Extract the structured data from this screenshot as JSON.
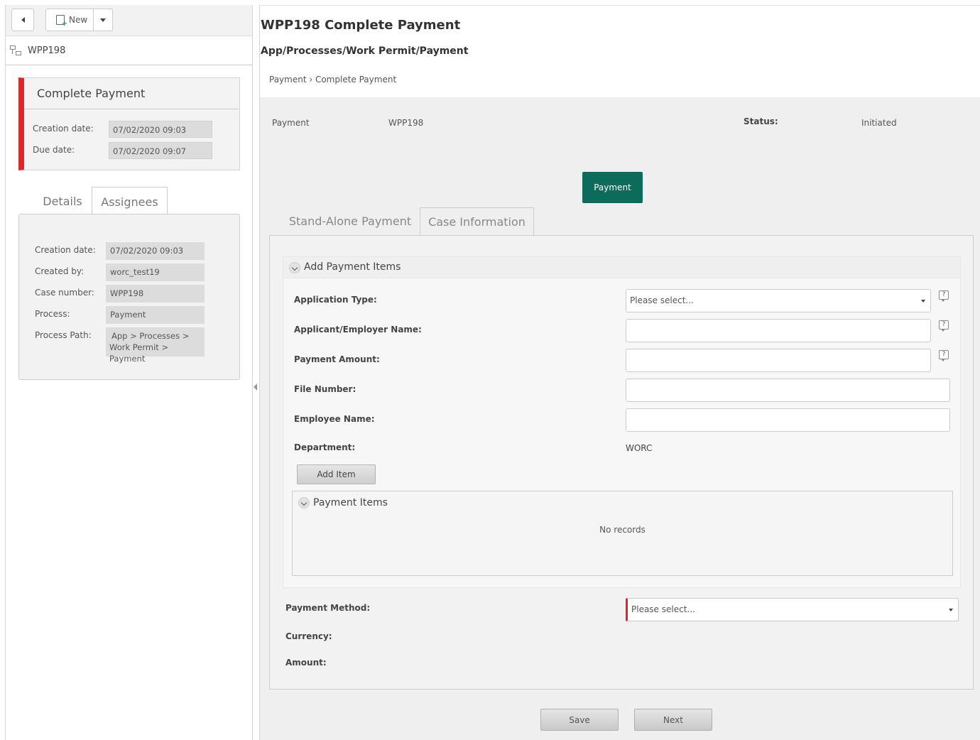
{
  "left": {
    "toolbar": {
      "new_label": "New"
    },
    "case_name": "WPP198",
    "task": {
      "title": "Complete Payment",
      "creation_label": "Creation date:",
      "creation_value": "07/02/2020 09:03",
      "due_label": "Due date:",
      "due_value": "07/02/2020 09:07"
    },
    "tabs": {
      "details": "Details",
      "assignees": "Assignees"
    },
    "details": {
      "creation_label": "Creation date:",
      "creation_value": "07/02/2020 09:03",
      "created_by_label": "Created by:",
      "created_by_value": "worc_test19",
      "case_number_label": "Case number:",
      "case_number_value": "WPP198",
      "process_label": "Process:",
      "process_value": "Payment",
      "process_path_label": "Process Path:",
      "process_path_value_line1": "App > Processes >",
      "process_path_value_line2": "Work Permit > Payment"
    }
  },
  "main": {
    "title": "WPP198 Complete Payment",
    "path": "App/Processes/Work Permit/Payment",
    "breadcrumb": "Payment › Complete Payment",
    "info": {
      "type_label": "Payment",
      "case_value": "WPP198",
      "status_label": "Status:",
      "status_value": "Initiated"
    },
    "stage_button": "Payment",
    "tabs": {
      "standalone": "Stand-Alone Payment",
      "case_info": "Case Information"
    },
    "add_items": {
      "title": "Add Payment Items",
      "application_type_label": "Application Type:",
      "application_type_value": "Please select...",
      "applicant_label": "Applicant/Employer Name:",
      "payment_amount_label": "Payment Amount:",
      "file_number_label": "File Number:",
      "employee_name_label": "Employee Name:",
      "department_label": "Department:",
      "department_value": "WORC",
      "add_item_button": "Add Item",
      "help_icon_text": "?"
    },
    "payment_items": {
      "title": "Payment Items",
      "empty_text": "No records"
    },
    "payment_method_label": "Payment Method:",
    "payment_method_value": "Please select...",
    "currency_label": "Currency:",
    "amount_label": "Amount:",
    "footer": {
      "save": "Save",
      "next": "Next"
    }
  },
  "colors": {
    "accent_teal": "#0d6b5c",
    "required_red": "#e0262c"
  }
}
